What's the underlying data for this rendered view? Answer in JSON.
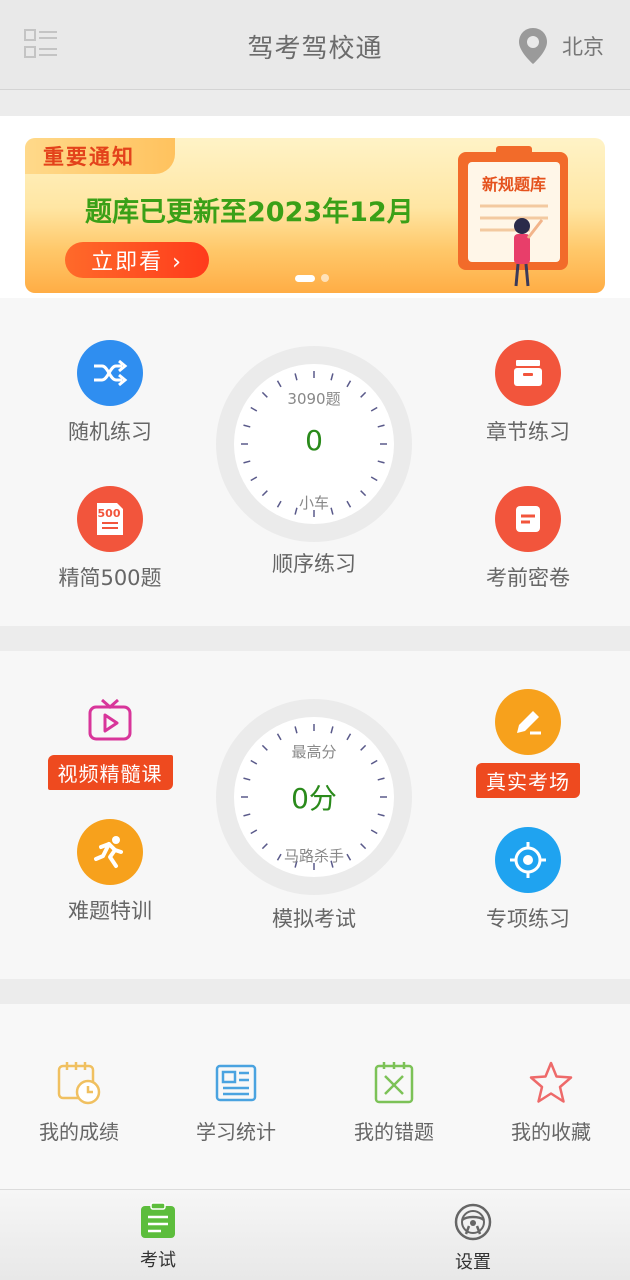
{
  "header": {
    "title": "驾考驾校通",
    "location": "北京",
    "menu_icon": "list-icon",
    "location_icon": "map-pin-icon"
  },
  "banner": {
    "tag": "重要通知",
    "headline": "题库已更新至2023年12月",
    "button": "立即看 ›",
    "art_text": "新规题库",
    "slide_count": 2,
    "active_slide": 1
  },
  "practice": {
    "random": {
      "label": "随机练习",
      "icon": "shuffle-icon",
      "color": "#2f8ef0"
    },
    "chapter": {
      "label": "章节练习",
      "icon": "archive-icon",
      "color": "#f2553c"
    },
    "simple500": {
      "label": "精简500题",
      "icon": "500-doc-icon",
      "color": "#f2553c"
    },
    "pre_exam": {
      "label": "考前密卷",
      "icon": "doc-icon",
      "color": "#f2553c"
    },
    "dial": {
      "top": "3090题",
      "value": "0",
      "bottom": "小车",
      "label": "顺序练习"
    }
  },
  "exam": {
    "video": {
      "label": "视频精髓课",
      "icon": "play-icon",
      "color": "#d8359a"
    },
    "real": {
      "label": "真实考场",
      "icon": "pencil-icon",
      "color": "#f7a11c"
    },
    "hard": {
      "label": "难题特训",
      "icon": "runner-icon",
      "color": "#f7a11c"
    },
    "special": {
      "label": "专项练习",
      "icon": "target-icon",
      "color": "#1fa3f0"
    },
    "dial": {
      "top": "最高分",
      "value": "0分",
      "bottom": "马路杀手",
      "label": "模拟考试"
    }
  },
  "stats": [
    {
      "label": "我的成绩",
      "icon": "calendar-clock-icon",
      "color": "#f0c060"
    },
    {
      "label": "学习统计",
      "icon": "newspaper-icon",
      "color": "#4aa3e0"
    },
    {
      "label": "我的错题",
      "icon": "wrong-list-icon",
      "color": "#7cc257"
    },
    {
      "label": "我的收藏",
      "icon": "star-icon",
      "color": "#ee6a6a"
    }
  ],
  "tabs": [
    {
      "label": "考试",
      "icon": "exam-tab-icon",
      "active": true,
      "color": "#5cbd3c"
    },
    {
      "label": "设置",
      "icon": "steering-wheel-icon",
      "active": false,
      "color": "#666666"
    }
  ]
}
